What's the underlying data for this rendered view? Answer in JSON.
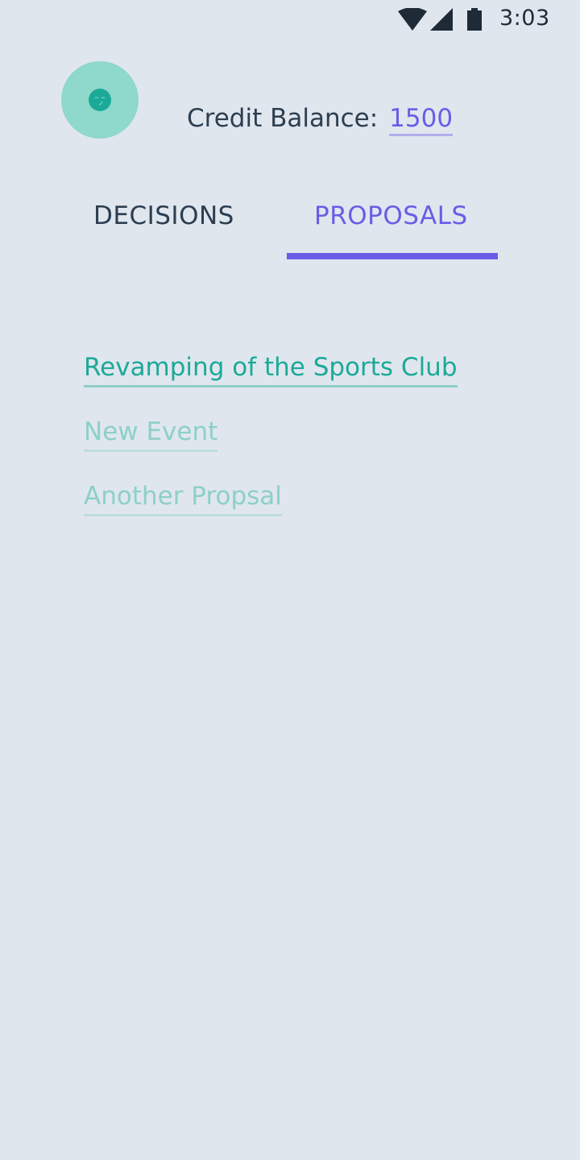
{
  "status_bar": {
    "time": "3:03",
    "icons": [
      "wifi-icon",
      "cell-signal-icon",
      "battery-icon"
    ]
  },
  "header": {
    "avatar_icon": "smiley-face-icon",
    "credit_label": "Credit Balance:",
    "credit_value": "1500"
  },
  "tabs": [
    {
      "label": "DECISIONS",
      "active": false
    },
    {
      "label": "PROPOSALS",
      "active": true
    }
  ],
  "proposals": [
    {
      "title": "Revamping of the Sports Club",
      "active": true
    },
    {
      "title": "New Event",
      "active": false
    },
    {
      "title": "Another Propsal",
      "active": false
    }
  ],
  "colors": {
    "background": "#E0E6EE",
    "accent_purple": "#6B5CE7",
    "teal": "#1BAA98",
    "teal_light": "#8DD0C6",
    "avatar_bg": "#8FD8CC",
    "text_dark": "#2C3E50"
  }
}
